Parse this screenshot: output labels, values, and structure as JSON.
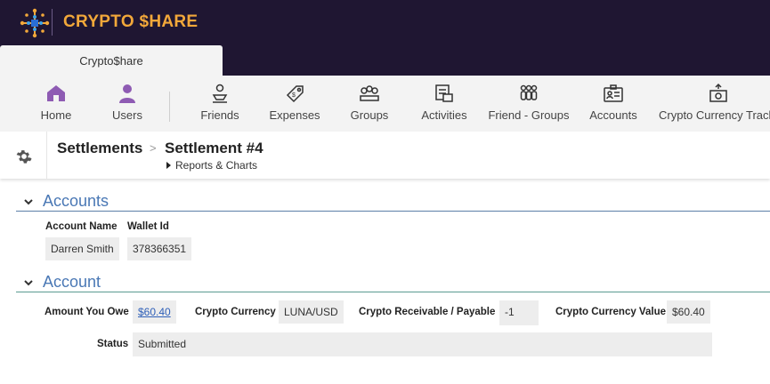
{
  "brand": {
    "name": "CRYPTO $HARE",
    "accent": "#f2a83a",
    "bar_color": "#1f1632"
  },
  "tabs": [
    {
      "label": "Crypto$hare",
      "active": true
    }
  ],
  "nav": {
    "items": [
      {
        "label": "Home",
        "icon": "home-icon"
      },
      {
        "label": "Users",
        "icon": "user-icon"
      },
      {
        "label": "Friends",
        "icon": "friends-icon"
      },
      {
        "label": "Expenses",
        "icon": "expense-tag-icon"
      },
      {
        "label": "Groups",
        "icon": "groups-icon"
      },
      {
        "label": "Activities",
        "icon": "activities-icon"
      },
      {
        "label": "Friend - Groups",
        "icon": "friend-groups-icon"
      },
      {
        "label": "Accounts",
        "icon": "accounts-card-icon"
      },
      {
        "label": "Crypto Currency Track",
        "icon": "currency-tracker-icon"
      }
    ]
  },
  "header": {
    "settings_icon": "gear-icon",
    "breadcrumb_parent": "Settlements",
    "breadcrumb_sep": ">",
    "breadcrumb_current": "Settlement #4",
    "subnav": "Reports & Charts"
  },
  "accounts_section": {
    "title": "Accounts",
    "col_account_name": "Account Name",
    "col_wallet_id": "Wallet Id",
    "account_name": "Darren Smith",
    "wallet_id": "378366351"
  },
  "account_section": {
    "title": "Account",
    "amount_label": "Amount You Owe",
    "amount_value": "$60.40",
    "currency_label": "Crypto Currency",
    "currency_value": "LUNA/USD",
    "receivable_label": "Crypto  Receivable / Payable",
    "receivable_value": "-1",
    "currency_value_label": "Crypto Currency Value",
    "currency_value_value": "$60.40",
    "status_label": "Status",
    "status_value": "Submitted"
  }
}
